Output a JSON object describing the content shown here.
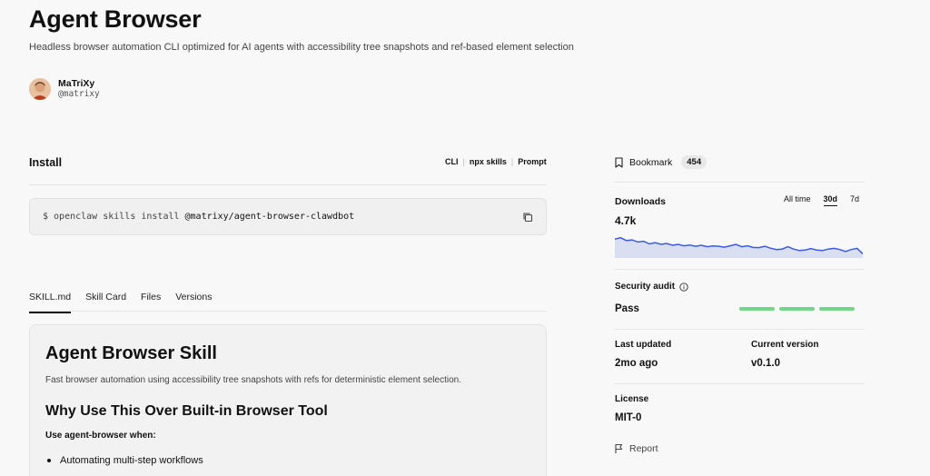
{
  "header": {
    "title": "Agent Browser",
    "subtitle": "Headless browser automation CLI optimized for AI agents with accessibility tree snapshots and ref-based element selection"
  },
  "author": {
    "name": "MaTriXy",
    "handle": "@matrixy"
  },
  "install": {
    "title": "Install",
    "options": [
      "CLI",
      "npx skills",
      "Prompt"
    ],
    "command_prefix": "$ openclaw skills install",
    "command_package": "@matrixy/agent-browser-clawdbot"
  },
  "tabs": [
    {
      "label": "SKILL.md",
      "active": true
    },
    {
      "label": "Skill Card",
      "active": false
    },
    {
      "label": "Files",
      "active": false
    },
    {
      "label": "Versions",
      "active": false
    }
  ],
  "skill": {
    "heading": "Agent Browser Skill",
    "intro": "Fast browser automation using accessibility tree snapshots with refs for deterministic element selection.",
    "h2": "Why Use This Over Built-in Browser Tool",
    "use_when": "Use agent-browser when:",
    "bullets": [
      "Automating multi-step workflows"
    ]
  },
  "sidebar": {
    "bookmark_label": "Bookmark",
    "bookmark_count": "454",
    "downloads_label": "Downloads",
    "downloads_value": "4.7k",
    "ranges": [
      "All time",
      "30d",
      "7d"
    ],
    "selected_range": "30d",
    "downloads_series": [
      0.72,
      0.78,
      0.66,
      0.69,
      0.6,
      0.63,
      0.52,
      0.57,
      0.5,
      0.54,
      0.46,
      0.5,
      0.44,
      0.47,
      0.42,
      0.46,
      0.4,
      0.43,
      0.42,
      0.38,
      0.44,
      0.5,
      0.4,
      0.44,
      0.37,
      0.36,
      0.42,
      0.34,
      0.28,
      0.3,
      0.4,
      0.3,
      0.24,
      0.26,
      0.32,
      0.26,
      0.24,
      0.3,
      0.33,
      0.28,
      0.2,
      0.28,
      0.33,
      0.1
    ],
    "accent_color": "#3b5bdb",
    "area_color": "#d9def0",
    "security_label": "Security audit",
    "security_value": "Pass",
    "security_color": "#6fd683",
    "last_updated_label": "Last updated",
    "last_updated_value": "2mo ago",
    "version_label": "Current version",
    "version_value": "v0.1.0",
    "license_label": "License",
    "license_value": "MIT-0",
    "report_label": "Report"
  }
}
